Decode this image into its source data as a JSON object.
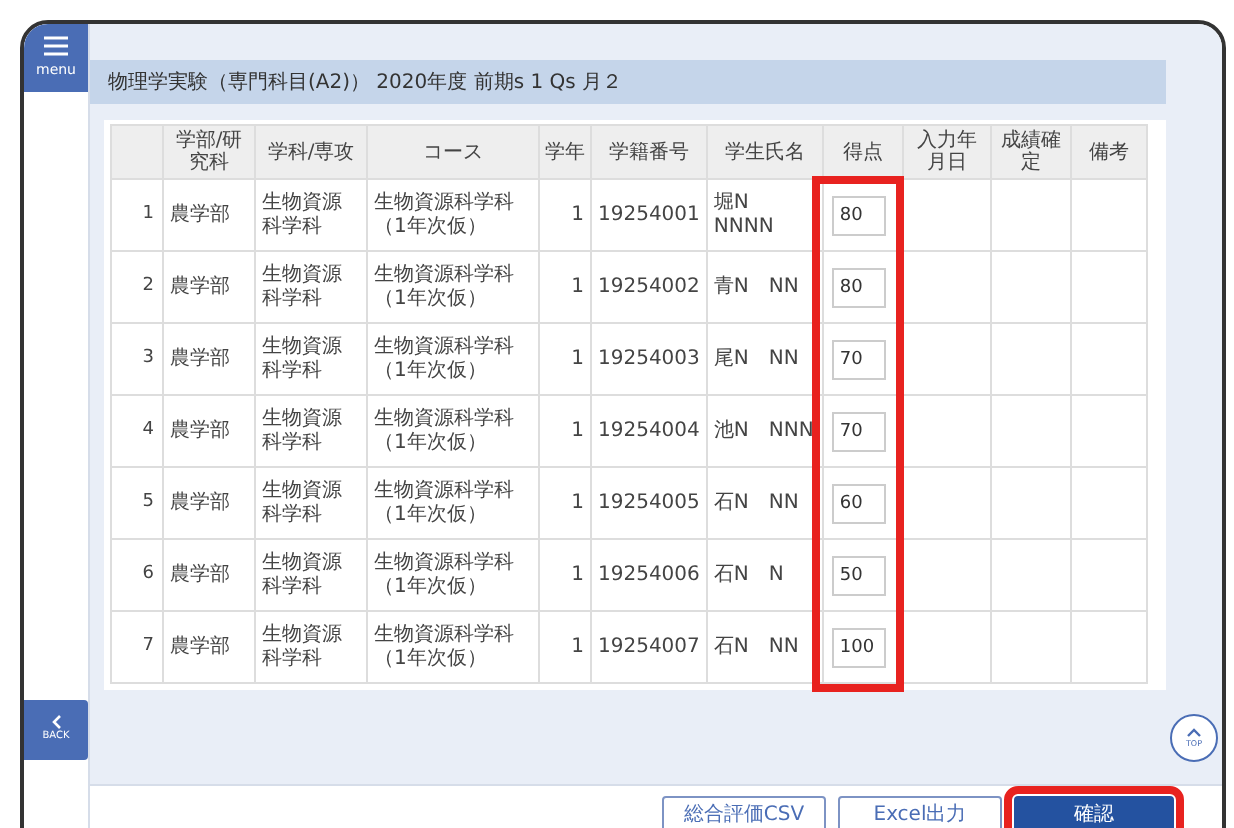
{
  "menu_button": {
    "label": "menu"
  },
  "title": "物理学実験（専門科目(A2)） 2020年度 前期s 1 Qs 月２",
  "table": {
    "columns": [
      "学部/研究科",
      "学科/専攻",
      "コース",
      "学年",
      "学籍番号",
      "学生氏名",
      "得点",
      "入力年月日",
      "成績確定",
      "備考"
    ],
    "score_column_highlighted": true,
    "rows": [
      {
        "no": "1",
        "faculty": "農学部",
        "department": "生物資源科学科",
        "course": "生物資源科学科（1年次仮）",
        "year": "1",
        "student_id": "19254001",
        "name": "堀N　NNNN",
        "score": "80"
      },
      {
        "no": "2",
        "faculty": "農学部",
        "department": "生物資源科学科",
        "course": "生物資源科学科（1年次仮）",
        "year": "1",
        "student_id": "19254002",
        "name": "青N　NN",
        "score": "80"
      },
      {
        "no": "3",
        "faculty": "農学部",
        "department": "生物資源科学科",
        "course": "生物資源科学科（1年次仮）",
        "year": "1",
        "student_id": "19254003",
        "name": "尾N　NN",
        "score": "70"
      },
      {
        "no": "4",
        "faculty": "農学部",
        "department": "生物資源科学科",
        "course": "生物資源科学科（1年次仮）",
        "year": "1",
        "student_id": "19254004",
        "name": "池N　NNN",
        "score": "70"
      },
      {
        "no": "5",
        "faculty": "農学部",
        "department": "生物資源科学科",
        "course": "生物資源科学科（1年次仮）",
        "year": "1",
        "student_id": "19254005",
        "name": "石N　NN",
        "score": "60"
      },
      {
        "no": "6",
        "faculty": "農学部",
        "department": "生物資源科学科",
        "course": "生物資源科学科（1年次仮）",
        "year": "1",
        "student_id": "19254006",
        "name": "石N　N",
        "score": "50"
      },
      {
        "no": "7",
        "faculty": "農学部",
        "department": "生物資源科学科",
        "course": "生物資源科学科（1年次仮）",
        "year": "1",
        "student_id": "19254007",
        "name": "石N　NN",
        "score": "100"
      }
    ]
  },
  "back_button": {
    "label": "BACK"
  },
  "top_button": {
    "label": "TOP"
  },
  "buttons": [
    {
      "label": "総合評価CSV",
      "kind": "outline",
      "highlighted": false
    },
    {
      "label": "Excel出力",
      "kind": "outline",
      "highlighted": false
    },
    {
      "label": "確認",
      "kind": "primary",
      "highlighted": true
    }
  ]
}
